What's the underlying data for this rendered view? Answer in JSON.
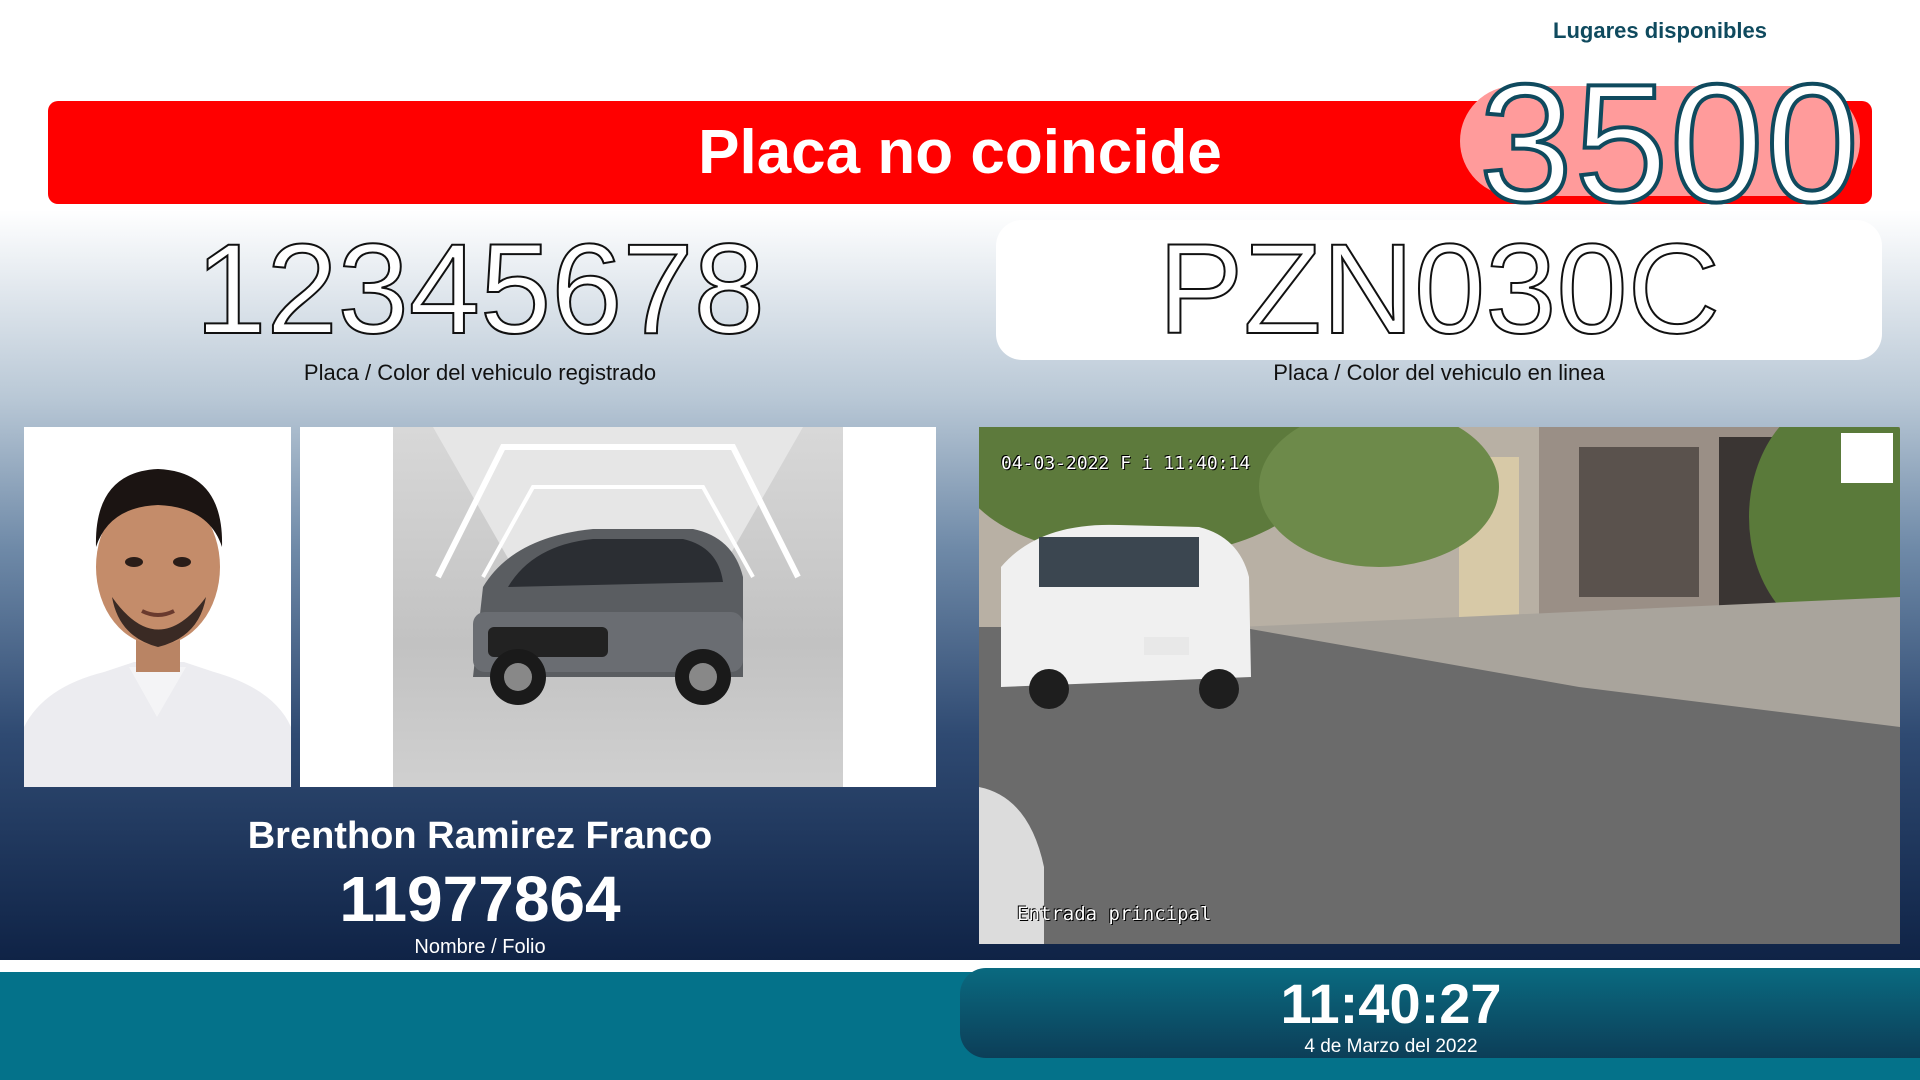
{
  "header": {
    "available_label": "Lugares disponibles",
    "available_count": "3500",
    "alert_message": "Placa no coincide",
    "alert_color": "#ff0000"
  },
  "plates": {
    "registered_plate": "12345678",
    "registered_caption": "Placa / Color del vehiculo registrado",
    "live_plate": "PZN030C",
    "live_caption": "Placa / Color del vehiculo en linea"
  },
  "person": {
    "name": "Brenthon Ramirez Franco",
    "folio": "11977864",
    "caption": "Nombre / Folio"
  },
  "camera": {
    "timestamp": "04-03-2022 F i 11:40:14",
    "location": "Entrada principal"
  },
  "clock": {
    "time": "11:40:27",
    "date": "4 de Marzo del 2022"
  },
  "colors": {
    "footer": "#04728a",
    "accent_dark": "#0f4a5e"
  }
}
